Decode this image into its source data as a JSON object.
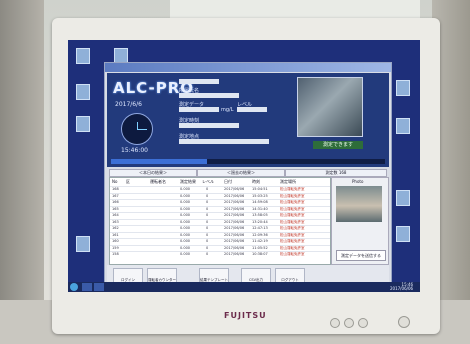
{
  "monitor": {
    "brand": "FUJITSU"
  },
  "app": {
    "logo": "ALC-PRO",
    "date": "2017/6/6",
    "time": "15:46:00",
    "fields": [
      {
        "label": "氏名",
        "value": ""
      },
      {
        "label": "所属氏名",
        "value": ""
      },
      {
        "label": "測定データ",
        "value": "",
        "unit": "mg/L",
        "extra_label": "レベル"
      },
      {
        "label": "測定時刻",
        "value": ""
      },
      {
        "label": "測定地点",
        "value": ""
      }
    ],
    "measure_button": "測定できます",
    "progress_percent": 35,
    "tabs": [
      "＜本日の結果＞",
      "＜過去の結果＞",
      "測定数 168"
    ],
    "table": {
      "headers": [
        "No",
        "区",
        "運転者名",
        "測定結果",
        "レベル",
        "日付",
        "時刻",
        "測定場所"
      ],
      "rows": [
        {
          "no": "168",
          "val": "0.000",
          "lv": "0",
          "date": "2017/06/06",
          "time": "15:04:51",
          "place": "松山運転免許室"
        },
        {
          "no": "167",
          "val": "0.000",
          "lv": "0",
          "date": "2017/06/06",
          "time": "15:03:25",
          "place": "松山運転免許室"
        },
        {
          "no": "166",
          "val": "0.000",
          "lv": "0",
          "date": "2017/06/06",
          "time": "14:59:08",
          "place": "松山運転免許室"
        },
        {
          "no": "165",
          "val": "0.000",
          "lv": "0",
          "date": "2017/06/06",
          "time": "14:31:40",
          "place": "松山運転免許室"
        },
        {
          "no": "164",
          "val": "0.000",
          "lv": "0",
          "date": "2017/06/06",
          "time": "13:58:05",
          "place": "松山運転免許室"
        },
        {
          "no": "163",
          "val": "0.000",
          "lv": "0",
          "date": "2017/06/06",
          "time": "13:20:44",
          "place": "松山運転免許室"
        },
        {
          "no": "162",
          "val": "0.000",
          "lv": "0",
          "date": "2017/06/06",
          "time": "12:47:13",
          "place": "松山運転免許室"
        },
        {
          "no": "161",
          "val": "0.000",
          "lv": "0",
          "date": "2017/06/06",
          "time": "12:09:36",
          "place": "松山運転免許室"
        },
        {
          "no": "160",
          "val": "0.000",
          "lv": "0",
          "date": "2017/06/06",
          "time": "11:42:19",
          "place": "松山運転免許室"
        },
        {
          "no": "159",
          "val": "0.000",
          "lv": "0",
          "date": "2017/06/06",
          "time": "11:05:52",
          "place": "松山運転免許室"
        },
        {
          "no": "158",
          "val": "0.000",
          "lv": "0",
          "date": "2017/06/06",
          "time": "10:38:07",
          "place": "松山運転免許室"
        }
      ]
    },
    "right_panel": {
      "title": "Photo",
      "send_button": "測定データを送信する"
    },
    "toolbar": [
      "ログイン",
      "運転者カウンター",
      "結果テンプレート",
      "CSV出力",
      "ログアウト"
    ]
  },
  "taskbar": {
    "time": "15:46",
    "date": "2017/06/06"
  },
  "colors": {
    "screen": "#1e2f7a",
    "header": "#223a7c",
    "accent": "#3c6fd6"
  }
}
